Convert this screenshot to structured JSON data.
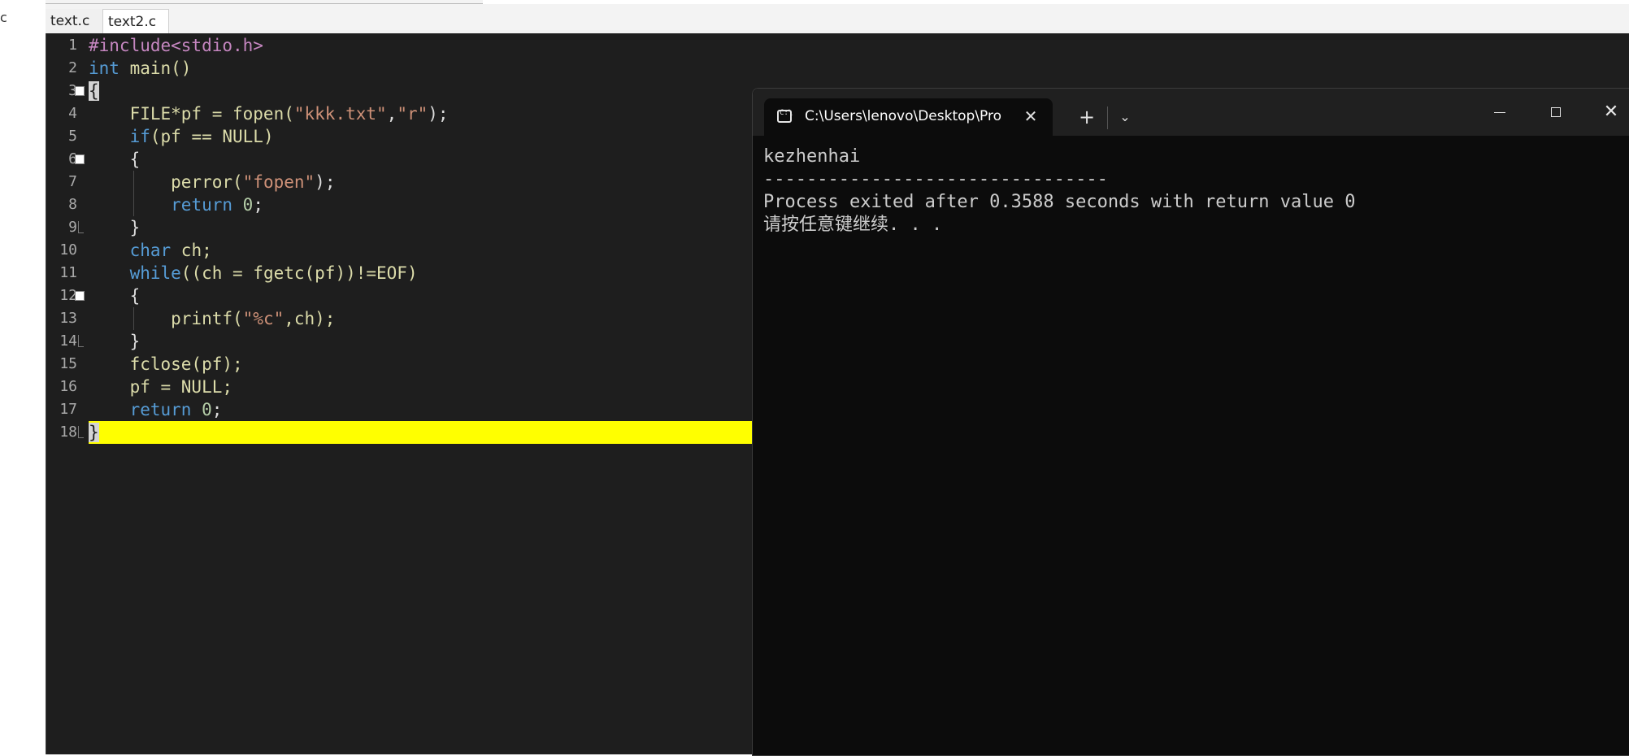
{
  "ide": {
    "tabs": [
      {
        "label": "text.c",
        "active": false
      },
      {
        "label": "text2.c",
        "active": true
      }
    ],
    "left_panel_fragment": "c",
    "current_line": 18,
    "code_lines": [
      {
        "n": "1",
        "tokens": [
          {
            "t": "#include<stdio.h>",
            "c": "pre"
          }
        ]
      },
      {
        "n": "2",
        "tokens": [
          {
            "t": "int",
            "c": "kw"
          },
          {
            "t": " main()",
            "c": "fn"
          }
        ]
      },
      {
        "n": "3",
        "tokens": [
          {
            "t": "{",
            "c": "sel"
          }
        ]
      },
      {
        "n": "4",
        "tokens": [
          {
            "t": "    FILE*pf = fopen(",
            "c": "fn"
          },
          {
            "t": "\"kkk.txt\"",
            "c": "str"
          },
          {
            "t": ",",
            "c": "plain"
          },
          {
            "t": "\"r\"",
            "c": "str"
          },
          {
            "t": ");",
            "c": "plain"
          }
        ]
      },
      {
        "n": "5",
        "tokens": [
          {
            "t": "    ",
            "c": "plain"
          },
          {
            "t": "if",
            "c": "kw"
          },
          {
            "t": "(pf == NULL)",
            "c": "fn"
          }
        ]
      },
      {
        "n": "6",
        "tokens": [
          {
            "t": "    {",
            "c": "plain"
          }
        ]
      },
      {
        "n": "7",
        "tokens": [
          {
            "t": "        perror(",
            "c": "fn"
          },
          {
            "t": "\"fopen\"",
            "c": "str"
          },
          {
            "t": ");",
            "c": "plain"
          }
        ]
      },
      {
        "n": "8",
        "tokens": [
          {
            "t": "        ",
            "c": "plain"
          },
          {
            "t": "return",
            "c": "kw"
          },
          {
            "t": " ",
            "c": "plain"
          },
          {
            "t": "0",
            "c": "num"
          },
          {
            "t": ";",
            "c": "plain"
          }
        ]
      },
      {
        "n": "9",
        "tokens": [
          {
            "t": "    }",
            "c": "plain"
          }
        ]
      },
      {
        "n": "10",
        "tokens": [
          {
            "t": "    ",
            "c": "plain"
          },
          {
            "t": "char",
            "c": "kw"
          },
          {
            "t": " ch;",
            "c": "fn"
          }
        ]
      },
      {
        "n": "11",
        "tokens": [
          {
            "t": "    ",
            "c": "plain"
          },
          {
            "t": "while",
            "c": "kw"
          },
          {
            "t": "((ch = fgetc(pf))!=EOF)",
            "c": "fn"
          }
        ]
      },
      {
        "n": "12",
        "tokens": [
          {
            "t": "    {",
            "c": "plain"
          }
        ]
      },
      {
        "n": "13",
        "tokens": [
          {
            "t": "        printf(",
            "c": "fn"
          },
          {
            "t": "\"%c\"",
            "c": "str"
          },
          {
            "t": ",ch);",
            "c": "fn"
          }
        ]
      },
      {
        "n": "14",
        "tokens": [
          {
            "t": "    }",
            "c": "plain"
          }
        ]
      },
      {
        "n": "15",
        "tokens": [
          {
            "t": "    fclose(pf);",
            "c": "fn"
          }
        ]
      },
      {
        "n": "16",
        "tokens": [
          {
            "t": "    pf = NULL;",
            "c": "fn"
          }
        ]
      },
      {
        "n": "17",
        "tokens": [
          {
            "t": "    ",
            "c": "plain"
          },
          {
            "t": "return",
            "c": "kw"
          },
          {
            "t": " ",
            "c": "plain"
          },
          {
            "t": "0",
            "c": "num"
          },
          {
            "t": ";",
            "c": "plain"
          }
        ]
      },
      {
        "n": "18",
        "tokens": [
          {
            "t": "}",
            "c": "sel"
          }
        ]
      }
    ]
  },
  "terminal": {
    "tab_title": "C:\\Users\\lenovo\\Desktop\\Pro",
    "close_tab_glyph": "✕",
    "new_tab_glyph": "+",
    "dropdown_glyph": "⌄",
    "close_window_glyph": "✕",
    "output": [
      "kezhenhai",
      "--------------------------------",
      "Process exited after 0.3588 seconds with return value 0",
      "请按任意键继续. . ."
    ]
  },
  "colors": {
    "editor_bg": "#1e1e1e",
    "current_line_highlight": "#ffff00",
    "terminal_bg": "#0c0c0c",
    "keyword": "#569cd6",
    "string": "#ce9178",
    "preprocessor": "#c586c0",
    "function_text": "#dcdcaa"
  },
  "icons": [
    "fold-marker-icon",
    "terminal-app-icon",
    "close-icon",
    "plus-icon",
    "chevron-down-icon",
    "minimize-icon",
    "maximize-icon"
  ]
}
